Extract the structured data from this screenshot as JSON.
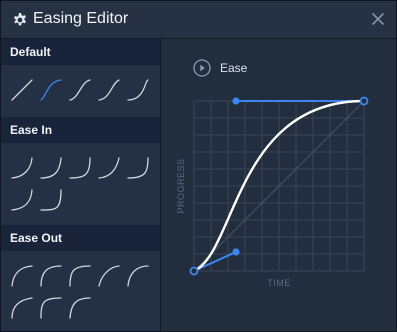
{
  "window": {
    "title": "Easing Editor",
    "icons": {
      "settings": "gear-icon",
      "close": "close-icon"
    }
  },
  "sidebar": {
    "sections": [
      {
        "label": "Default",
        "count": 5
      },
      {
        "label": "Ease In",
        "count": 7
      },
      {
        "label": "Ease Out",
        "count": 8
      }
    ]
  },
  "editor": {
    "preset_name": "Ease",
    "play_icon": "play-icon",
    "axis": {
      "x_label": "TIME",
      "y_label": "PROGRESS"
    },
    "curve": {
      "type": "cubic-bezier",
      "p1": [
        0.25,
        0.1
      ],
      "p2": [
        0.25,
        1.0
      ]
    }
  },
  "colors": {
    "accent": "#3d86f0",
    "curve": "#ffffff",
    "background": "#222d3e",
    "section_header": "#19233a",
    "grid": "#3a4658"
  }
}
